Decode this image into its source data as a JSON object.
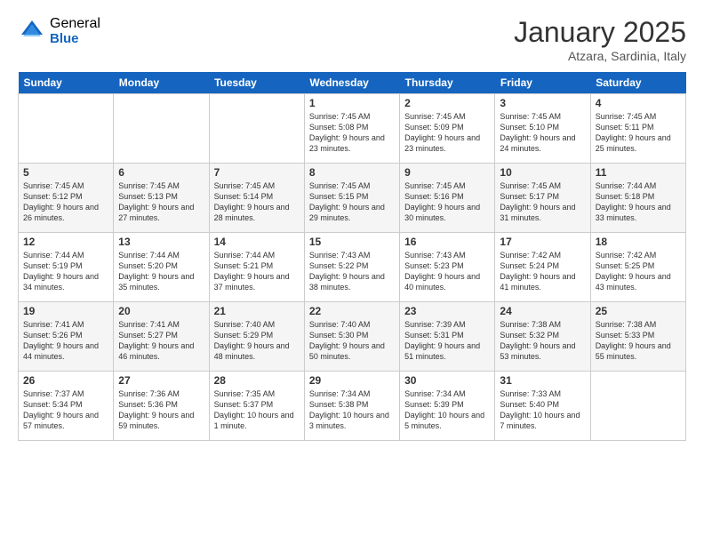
{
  "logo": {
    "general": "General",
    "blue": "Blue"
  },
  "title": "January 2025",
  "location": "Atzara, Sardinia, Italy",
  "days_of_week": [
    "Sunday",
    "Monday",
    "Tuesday",
    "Wednesday",
    "Thursday",
    "Friday",
    "Saturday"
  ],
  "weeks": [
    [
      {
        "day": "",
        "info": ""
      },
      {
        "day": "",
        "info": ""
      },
      {
        "day": "",
        "info": ""
      },
      {
        "day": "1",
        "info": "Sunrise: 7:45 AM\nSunset: 5:08 PM\nDaylight: 9 hours and 23 minutes."
      },
      {
        "day": "2",
        "info": "Sunrise: 7:45 AM\nSunset: 5:09 PM\nDaylight: 9 hours and 23 minutes."
      },
      {
        "day": "3",
        "info": "Sunrise: 7:45 AM\nSunset: 5:10 PM\nDaylight: 9 hours and 24 minutes."
      },
      {
        "day": "4",
        "info": "Sunrise: 7:45 AM\nSunset: 5:11 PM\nDaylight: 9 hours and 25 minutes."
      }
    ],
    [
      {
        "day": "5",
        "info": "Sunrise: 7:45 AM\nSunset: 5:12 PM\nDaylight: 9 hours and 26 minutes."
      },
      {
        "day": "6",
        "info": "Sunrise: 7:45 AM\nSunset: 5:13 PM\nDaylight: 9 hours and 27 minutes."
      },
      {
        "day": "7",
        "info": "Sunrise: 7:45 AM\nSunset: 5:14 PM\nDaylight: 9 hours and 28 minutes."
      },
      {
        "day": "8",
        "info": "Sunrise: 7:45 AM\nSunset: 5:15 PM\nDaylight: 9 hours and 29 minutes."
      },
      {
        "day": "9",
        "info": "Sunrise: 7:45 AM\nSunset: 5:16 PM\nDaylight: 9 hours and 30 minutes."
      },
      {
        "day": "10",
        "info": "Sunrise: 7:45 AM\nSunset: 5:17 PM\nDaylight: 9 hours and 31 minutes."
      },
      {
        "day": "11",
        "info": "Sunrise: 7:44 AM\nSunset: 5:18 PM\nDaylight: 9 hours and 33 minutes."
      }
    ],
    [
      {
        "day": "12",
        "info": "Sunrise: 7:44 AM\nSunset: 5:19 PM\nDaylight: 9 hours and 34 minutes."
      },
      {
        "day": "13",
        "info": "Sunrise: 7:44 AM\nSunset: 5:20 PM\nDaylight: 9 hours and 35 minutes."
      },
      {
        "day": "14",
        "info": "Sunrise: 7:44 AM\nSunset: 5:21 PM\nDaylight: 9 hours and 37 minutes."
      },
      {
        "day": "15",
        "info": "Sunrise: 7:43 AM\nSunset: 5:22 PM\nDaylight: 9 hours and 38 minutes."
      },
      {
        "day": "16",
        "info": "Sunrise: 7:43 AM\nSunset: 5:23 PM\nDaylight: 9 hours and 40 minutes."
      },
      {
        "day": "17",
        "info": "Sunrise: 7:42 AM\nSunset: 5:24 PM\nDaylight: 9 hours and 41 minutes."
      },
      {
        "day": "18",
        "info": "Sunrise: 7:42 AM\nSunset: 5:25 PM\nDaylight: 9 hours and 43 minutes."
      }
    ],
    [
      {
        "day": "19",
        "info": "Sunrise: 7:41 AM\nSunset: 5:26 PM\nDaylight: 9 hours and 44 minutes."
      },
      {
        "day": "20",
        "info": "Sunrise: 7:41 AM\nSunset: 5:27 PM\nDaylight: 9 hours and 46 minutes."
      },
      {
        "day": "21",
        "info": "Sunrise: 7:40 AM\nSunset: 5:29 PM\nDaylight: 9 hours and 48 minutes."
      },
      {
        "day": "22",
        "info": "Sunrise: 7:40 AM\nSunset: 5:30 PM\nDaylight: 9 hours and 50 minutes."
      },
      {
        "day": "23",
        "info": "Sunrise: 7:39 AM\nSunset: 5:31 PM\nDaylight: 9 hours and 51 minutes."
      },
      {
        "day": "24",
        "info": "Sunrise: 7:38 AM\nSunset: 5:32 PM\nDaylight: 9 hours and 53 minutes."
      },
      {
        "day": "25",
        "info": "Sunrise: 7:38 AM\nSunset: 5:33 PM\nDaylight: 9 hours and 55 minutes."
      }
    ],
    [
      {
        "day": "26",
        "info": "Sunrise: 7:37 AM\nSunset: 5:34 PM\nDaylight: 9 hours and 57 minutes."
      },
      {
        "day": "27",
        "info": "Sunrise: 7:36 AM\nSunset: 5:36 PM\nDaylight: 9 hours and 59 minutes."
      },
      {
        "day": "28",
        "info": "Sunrise: 7:35 AM\nSunset: 5:37 PM\nDaylight: 10 hours and 1 minute."
      },
      {
        "day": "29",
        "info": "Sunrise: 7:34 AM\nSunset: 5:38 PM\nDaylight: 10 hours and 3 minutes."
      },
      {
        "day": "30",
        "info": "Sunrise: 7:34 AM\nSunset: 5:39 PM\nDaylight: 10 hours and 5 minutes."
      },
      {
        "day": "31",
        "info": "Sunrise: 7:33 AM\nSunset: 5:40 PM\nDaylight: 10 hours and 7 minutes."
      },
      {
        "day": "",
        "info": ""
      }
    ]
  ]
}
